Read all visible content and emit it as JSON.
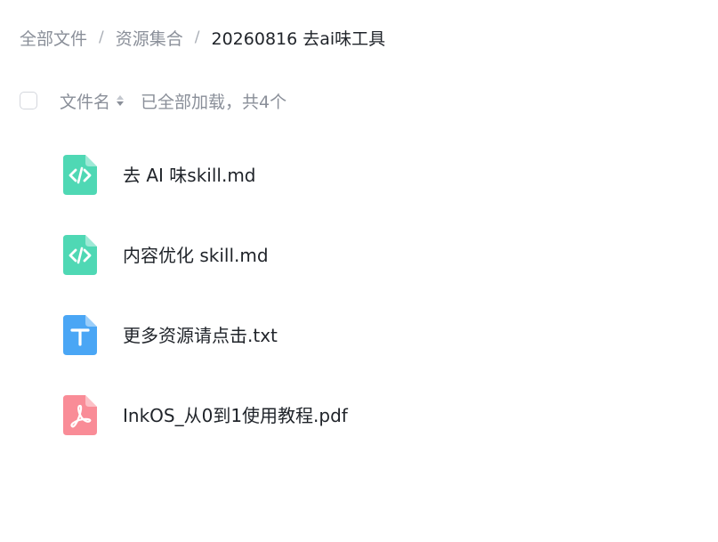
{
  "breadcrumb": {
    "items": [
      "全部文件",
      "资源集合"
    ],
    "separator": "/",
    "current": "20260816 去ai味工具"
  },
  "list_header": {
    "column_label": "文件名",
    "status": "已全部加载，共4个"
  },
  "files": [
    {
      "name": "去 AI 味skill.md",
      "icon": "code-file-icon",
      "color": "#4fd8b4"
    },
    {
      "name": "内容优化 skill.md",
      "icon": "code-file-icon",
      "color": "#4fd8b4"
    },
    {
      "name": "更多资源请点击.txt",
      "icon": "text-file-icon",
      "color": "#4aa6f5"
    },
    {
      "name": "InkOS_从0到1使用教程.pdf",
      "icon": "pdf-file-icon",
      "color": "#f98c97"
    }
  ]
}
